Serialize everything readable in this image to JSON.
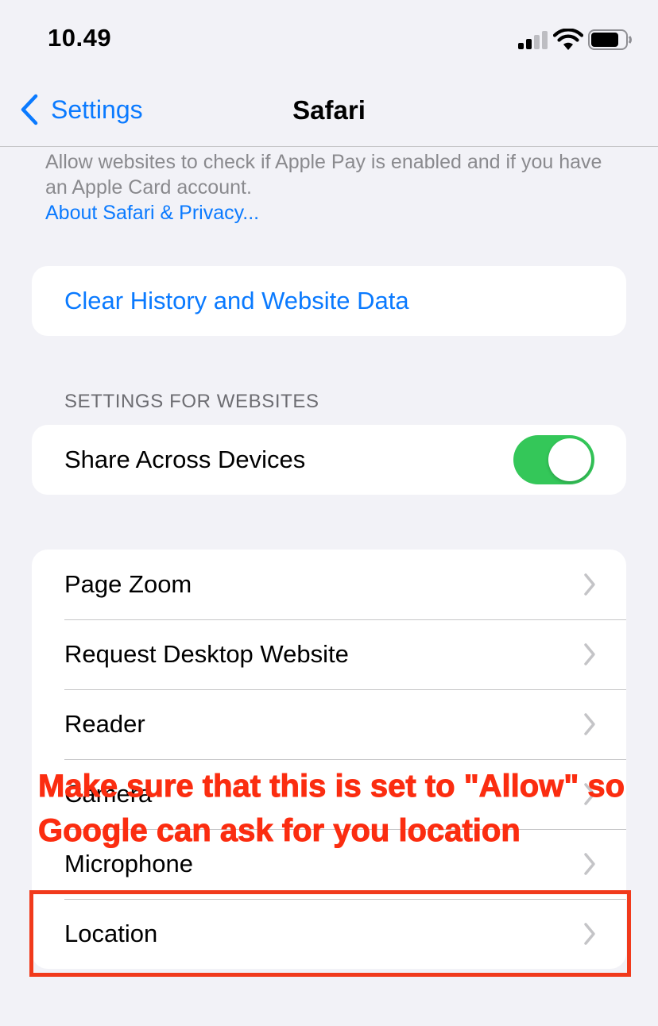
{
  "status_bar": {
    "time": "10.49",
    "signal_bars_active": 2,
    "signal_bars_total": 4,
    "battery_level": 0.8
  },
  "nav": {
    "back_label": "Settings",
    "title": "Safari"
  },
  "privacy_footer": {
    "text": "Allow websites to check if Apple Pay is enabled and if you have an Apple Card account.",
    "link": "About Safari & Privacy..."
  },
  "clear_history": {
    "label": "Clear History and Website Data"
  },
  "settings_for_websites": {
    "header": "SETTINGS FOR WEBSITES",
    "share_across_devices": {
      "label": "Share Across Devices",
      "enabled": true
    }
  },
  "website_settings": {
    "items": [
      {
        "label": "Page Zoom"
      },
      {
        "label": "Request Desktop Website"
      },
      {
        "label": "Reader"
      },
      {
        "label": "Camera"
      },
      {
        "label": "Microphone"
      },
      {
        "label": "Location"
      }
    ]
  },
  "annotation": {
    "text": "Make sure that this is set to \"Allow\" so Google can ask for you location"
  },
  "colors": {
    "accent": "#0a7aff",
    "toggle_on": "#34c759",
    "annotation": "#fb2d10",
    "background": "#f2f2f7"
  }
}
